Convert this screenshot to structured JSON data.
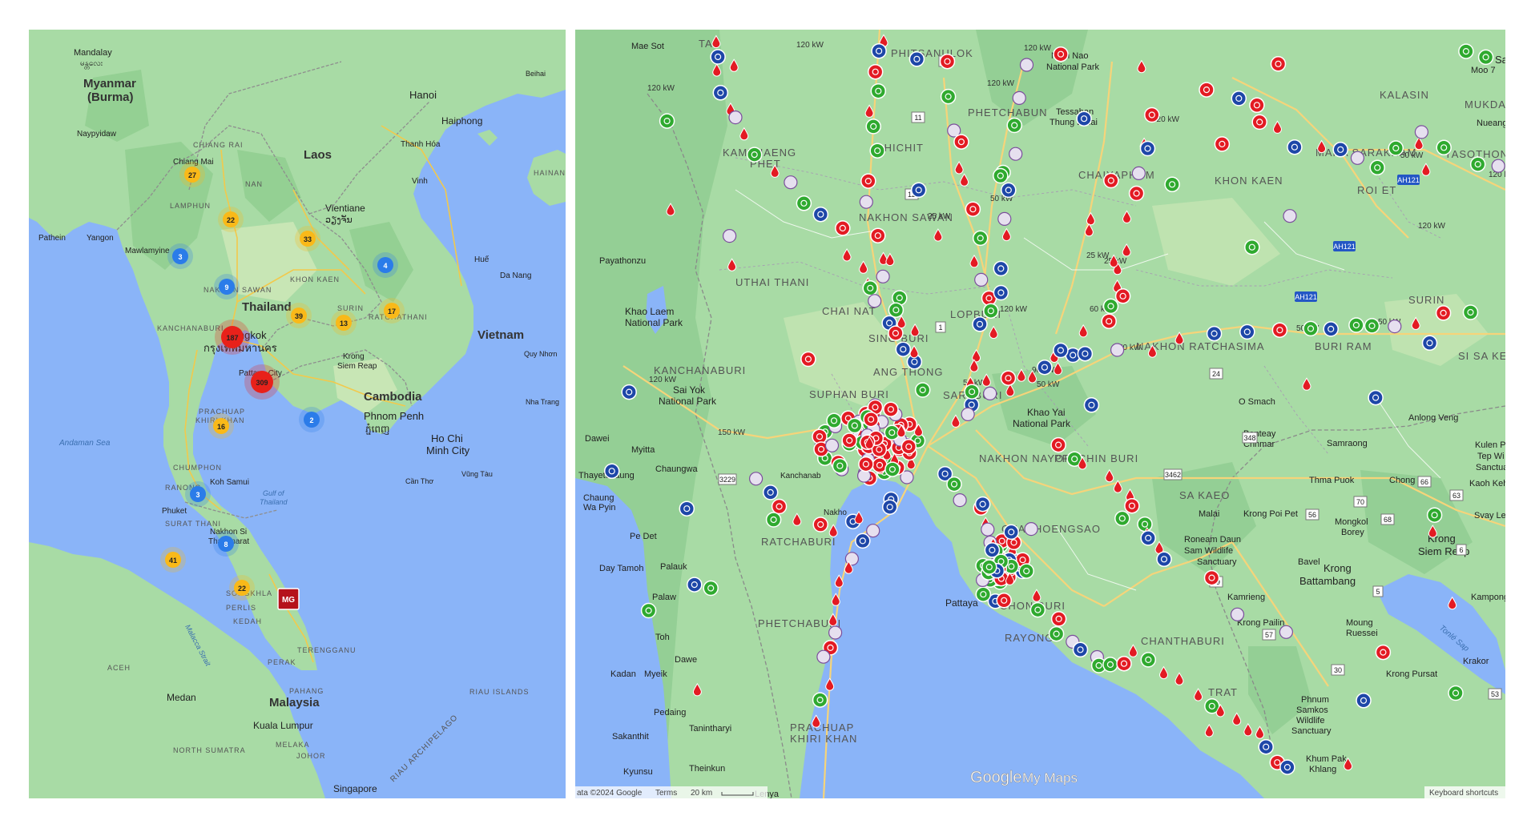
{
  "left_map": {
    "labels": {
      "countries": [
        {
          "id": "myanmar",
          "text": "Myanmar"
        },
        {
          "id": "myanmar2",
          "text": "(Burma)"
        },
        {
          "id": "thailand",
          "text": "Thailand"
        },
        {
          "id": "laos",
          "text": "Laos"
        },
        {
          "id": "cambodia",
          "text": "Cambodia"
        },
        {
          "id": "vietnam",
          "text": "Vietnam"
        },
        {
          "id": "malaysia",
          "text": "Malaysia"
        }
      ],
      "cities": [
        {
          "id": "mandalay",
          "text": "Mandalay"
        },
        {
          "id": "mandalay_local",
          "text": "မန္တလေး"
        },
        {
          "id": "naypyidaw",
          "text": "Naypyidaw"
        },
        {
          "id": "yangon",
          "text": "Yangon"
        },
        {
          "id": "pathein",
          "text": "Pathein"
        },
        {
          "id": "mawlamyine",
          "text": "Mawlamyine"
        },
        {
          "id": "chiangmai",
          "text": "Chiang Mai"
        },
        {
          "id": "hanoi",
          "text": "Hanoi"
        },
        {
          "id": "haiphong",
          "text": "Haiphong"
        },
        {
          "id": "vientiane",
          "text": "Vientiane"
        },
        {
          "id": "vientiane_local",
          "text": "ວຽງຈັນ"
        },
        {
          "id": "bangkok",
          "text": "Bangkok"
        },
        {
          "id": "bangkok_local",
          "text": "กรุงเทพมหานคร"
        },
        {
          "id": "pattaya",
          "text": "Pattaya City"
        },
        {
          "id": "phnompenh",
          "text": "Phnom Penh"
        },
        {
          "id": "phnompenh_local",
          "text": "ភ្នំពេញ"
        },
        {
          "id": "hcmc",
          "text": "Ho Chi"
        },
        {
          "id": "hcmc2",
          "text": "Minh City"
        },
        {
          "id": "siemreap",
          "text": "Krong"
        },
        {
          "id": "siemreap2",
          "text": "Siem Reap"
        },
        {
          "id": "danang",
          "text": "Da Nang"
        },
        {
          "id": "hue",
          "text": "Huế"
        },
        {
          "id": "vinh",
          "text": "Vinh"
        },
        {
          "id": "thanhhoa",
          "text": "Thanh Hóa"
        },
        {
          "id": "kualalumpur",
          "text": "Kuala Lumpur"
        },
        {
          "id": "singapore",
          "text": "Singapore"
        },
        {
          "id": "medan",
          "text": "Medan"
        },
        {
          "id": "phuket",
          "text": "Phuket"
        },
        {
          "id": "kohsamui",
          "text": "Koh Samui"
        },
        {
          "id": "nakhonsi",
          "text": "Nakhon Si"
        },
        {
          "id": "nakhonsi2",
          "text": "Thammarat"
        },
        {
          "id": "canthos",
          "text": "Cần Thơ"
        },
        {
          "id": "vungtau",
          "text": "Vũng Tàu"
        },
        {
          "id": "quynhon",
          "text": "Quy Nhơn"
        },
        {
          "id": "nhatrang",
          "text": "Nha Trang"
        },
        {
          "id": "beihai",
          "text": "Beihai"
        }
      ],
      "provinces": [
        {
          "id": "chiangrai",
          "text": "CHIANG RAI"
        },
        {
          "id": "lamphun",
          "text": "LAMPHUN"
        },
        {
          "id": "nan",
          "text": "NAN"
        },
        {
          "id": "nakhonsawan",
          "text": "NAKHON SAWAN"
        },
        {
          "id": "khonkaen",
          "text": "KHON KAEN"
        },
        {
          "id": "kanchanaburi",
          "text": "KANCHANABURI"
        },
        {
          "id": "prachuap",
          "text": "PRACHUAP"
        },
        {
          "id": "prachuap2",
          "text": "KHIRI KHAN"
        },
        {
          "id": "chumphon",
          "text": "CHUMPHON"
        },
        {
          "id": "ranong",
          "text": "RANONG"
        },
        {
          "id": "suratthani",
          "text": "SURAT THANI"
        },
        {
          "id": "songkhla",
          "text": "SONGKHLA"
        },
        {
          "id": "perlis",
          "text": "PERLIS"
        },
        {
          "id": "kedah",
          "text": "KEDAH"
        },
        {
          "id": "perak",
          "text": "PERAK"
        },
        {
          "id": "terengganu",
          "text": "TERENGGANU"
        },
        {
          "id": "pahang",
          "text": "PAHANG"
        },
        {
          "id": "melaka",
          "text": "MELAKA"
        },
        {
          "id": "johor",
          "text": "JOHOR"
        },
        {
          "id": "aceh",
          "text": "ACEH"
        },
        {
          "id": "northsumatra",
          "text": "NORTH SUMATRA"
        },
        {
          "id": "riauislands",
          "text": "RIAU ISLANDS"
        },
        {
          "id": "riauarch",
          "text": "RIAU ARCHIPELAGO"
        },
        {
          "id": "surin",
          "text": "SURIN"
        },
        {
          "id": "ratchathani",
          "text": "RATCHATHANI"
        },
        {
          "id": "hainan",
          "text": "HAINAN"
        }
      ],
      "seas": [
        {
          "id": "andaman",
          "text": "Andaman Sea"
        },
        {
          "id": "gulf",
          "text": "Gulf of"
        },
        {
          "id": "gulf2",
          "text": "Thailand"
        },
        {
          "id": "malacca",
          "text": "Malacca Strait"
        }
      ]
    },
    "clusters": [
      {
        "count": "27",
        "color": "#f9b919"
      },
      {
        "count": "22",
        "color": "#f9b919"
      },
      {
        "count": "3",
        "color": "#2b7ce9"
      },
      {
        "count": "33",
        "color": "#f9b919"
      },
      {
        "count": "4",
        "color": "#2b7ce9"
      },
      {
        "count": "9",
        "color": "#2b7ce9"
      },
      {
        "count": "39",
        "color": "#f9b919"
      },
      {
        "count": "13",
        "color": "#f9b919"
      },
      {
        "count": "17",
        "color": "#f9b919"
      },
      {
        "count": "187",
        "color": "#e8211a"
      },
      {
        "count": "309",
        "color": "#e8211a"
      },
      {
        "count": "2",
        "color": "#2b7ce9"
      },
      {
        "count": "16",
        "color": "#f9b919"
      },
      {
        "count": "3",
        "color": "#2b7ce9"
      },
      {
        "count": "8",
        "color": "#2b7ce9"
      },
      {
        "count": "41",
        "color": "#f9b919"
      },
      {
        "count": "22",
        "color": "#f9b919"
      }
    ],
    "mg_marker": "MG"
  },
  "right_map": {
    "labels": {
      "provinces": [
        {
          "id": "tak",
          "text": "TAK"
        },
        {
          "id": "phitsanulok",
          "text": "PHITSANULOK"
        },
        {
          "id": "phetchabun",
          "text": "PHETCHABUN"
        },
        {
          "id": "kamphaengphet",
          "text": "KAMPHAENG"
        },
        {
          "id": "kamphaengphet2",
          "text": "PHET"
        },
        {
          "id": "phichit",
          "text": "PHICHIT"
        },
        {
          "id": "chaiyaphum",
          "text": "CHAIYAPHUM"
        },
        {
          "id": "khonkaen",
          "text": "KHON KAEN"
        },
        {
          "id": "kalasin",
          "text": "KALASIN"
        },
        {
          "id": "mukdahan",
          "text": "MUKDAHAN"
        },
        {
          "id": "maha",
          "text": "MAHA SARAKHAM"
        },
        {
          "id": "yasothon",
          "text": "YASOTHON"
        },
        {
          "id": "roiet",
          "text": "ROI ET"
        },
        {
          "id": "nakhonsawan",
          "text": "NAKHON SAWAN"
        },
        {
          "id": "uthaithani",
          "text": "UTHAI THANI"
        },
        {
          "id": "chainat",
          "text": "CHAI NAT"
        },
        {
          "id": "lopburi",
          "text": "LOPBURI"
        },
        {
          "id": "singburi",
          "text": "SING BURI"
        },
        {
          "id": "angthong",
          "text": "ANG THONG"
        },
        {
          "id": "kanchanaburi",
          "text": "KANCHANABURI"
        },
        {
          "id": "suphanburi",
          "text": "SUPHAN BURI"
        },
        {
          "id": "saraburi",
          "text": "SARABURI"
        },
        {
          "id": "nakhonratchasima",
          "text": "NAKHON RATCHASIMA"
        },
        {
          "id": "buriram",
          "text": "BURI RAM"
        },
        {
          "id": "surin",
          "text": "SURIN"
        },
        {
          "id": "sisaket",
          "text": "SI SA KET"
        },
        {
          "id": "nakhonnayok",
          "text": "NAKHON NAYOK"
        },
        {
          "id": "prachinburi",
          "text": "PRACHIN BURI"
        },
        {
          "id": "sakaeo",
          "text": "SA KAEO"
        },
        {
          "id": "chachoengsao",
          "text": "CHACHOENGSAO"
        },
        {
          "id": "ratchaburi",
          "text": "RATCHABURI"
        },
        {
          "id": "phetchaburi",
          "text": "PHETCHABURI"
        },
        {
          "id": "chonburi",
          "text": "CHON BURI"
        },
        {
          "id": "rayong",
          "text": "RAYONG"
        },
        {
          "id": "chanthaburi",
          "text": "CHANTHABURI"
        },
        {
          "id": "trat",
          "text": "TRAT"
        },
        {
          "id": "prachuap",
          "text": "PRACHUAP"
        },
        {
          "id": "prachuap2",
          "text": "KHIRI KHAN"
        }
      ],
      "places": [
        {
          "id": "maesot",
          "text": "Mae Sot"
        },
        {
          "id": "namnao",
          "text": "Nam Nao"
        },
        {
          "id": "namnao2",
          "text": "National Park"
        },
        {
          "id": "tessaban",
          "text": "Tessaban"
        },
        {
          "id": "tessaban2",
          "text": "Thung Luilai"
        },
        {
          "id": "payathonzu",
          "text": "Payathonzu"
        },
        {
          "id": "khaolaem",
          "text": "Khao Laem"
        },
        {
          "id": "khaolaem2",
          "text": "National Park"
        },
        {
          "id": "saiyok",
          "text": "Sai Yok"
        },
        {
          "id": "saiyok2",
          "text": "National Park"
        },
        {
          "id": "khaoyai",
          "text": "Khao Yai"
        },
        {
          "id": "khaoyai2",
          "text": "National Park"
        },
        {
          "id": "thanbyuzayat",
          "text": "Dawei"
        },
        {
          "id": "myitta",
          "text": "Myitta"
        },
        {
          "id": "chaungwa",
          "text": "Chaungwa"
        },
        {
          "id": "thayetchaung",
          "text": "Thayetchaung"
        },
        {
          "id": "chaung",
          "text": "Chaung"
        },
        {
          "id": "wapyin",
          "text": "Wa Pyin"
        },
        {
          "id": "pedet",
          "text": "Pe Det"
        },
        {
          "id": "daytamoh",
          "text": "Day Tamoh"
        },
        {
          "id": "palauk",
          "text": "Palauk"
        },
        {
          "id": "palaw",
          "text": "Palaw"
        },
        {
          "id": "toh",
          "text": "Toh"
        },
        {
          "id": "dawe",
          "text": "Dawe"
        },
        {
          "id": "kadan",
          "text": "Kadan"
        },
        {
          "id": "myeik",
          "text": "Myeik"
        },
        {
          "id": "pedaing",
          "text": "Pedaing"
        },
        {
          "id": "tanintharyi",
          "text": "Tanintharyi"
        },
        {
          "id": "sakanthit",
          "text": "Sakanthit"
        },
        {
          "id": "theinkun",
          "text": "Theinkun"
        },
        {
          "id": "kyunsu",
          "text": "Kyunsu"
        },
        {
          "id": "lenya",
          "text": "Lenya"
        },
        {
          "id": "pattaya",
          "text": "Pattaya"
        },
        {
          "id": "osmach",
          "text": "O Smach"
        },
        {
          "id": "banteay",
          "text": "Banteay"
        },
        {
          "id": "banteay2",
          "text": "Chhmar"
        },
        {
          "id": "samraong",
          "text": "Samraong"
        },
        {
          "id": "anlongveng",
          "text": "Anlong Veng"
        },
        {
          "id": "kulen",
          "text": "Kulen Pr"
        },
        {
          "id": "kulen2",
          "text": "Tep Wi"
        },
        {
          "id": "kulen3",
          "text": "Sanctua"
        },
        {
          "id": "thmapuok",
          "text": "Thma Puok"
        },
        {
          "id": "chongkal",
          "text": "Chong Kal"
        },
        {
          "id": "kaokeh",
          "text": "Kaoh Keh"
        },
        {
          "id": "kongpoipet",
          "text": "Krong Poi Pet"
        },
        {
          "id": "mongkol",
          "text": "Mongkol"
        },
        {
          "id": "mongkol2",
          "text": "Borey"
        },
        {
          "id": "svayleu",
          "text": "Svay Le"
        },
        {
          "id": "siemreap",
          "text": "Krong"
        },
        {
          "id": "siemreap2",
          "text": "Siem Reap"
        },
        {
          "id": "battambang",
          "text": "Krong"
        },
        {
          "id": "battambang2",
          "text": "Battambang"
        },
        {
          "id": "roneam",
          "text": "Roneam Daun"
        },
        {
          "id": "roneam2",
          "text": "Sam Wildlife"
        },
        {
          "id": "roneam3",
          "text": "Sanctuary"
        },
        {
          "id": "bavel",
          "text": "Bavel"
        },
        {
          "id": "kamrieng",
          "text": "Kamrieng"
        },
        {
          "id": "pailin",
          "text": "Krong Pailin"
        },
        {
          "id": "moung",
          "text": "Moung"
        },
        {
          "id": "moung2",
          "text": "Ruessei"
        },
        {
          "id": "kompong",
          "text": "Kampong"
        },
        {
          "id": "pursat",
          "text": "Krong Pursat"
        },
        {
          "id": "krakor",
          "text": "Krakor"
        },
        {
          "id": "phnumsamkos",
          "text": "Phnum"
        },
        {
          "id": "phnumsamkos2",
          "text": "Samkos"
        },
        {
          "id": "phnumsamkos3",
          "text": "Wildlife"
        },
        {
          "id": "phnumsamkos4",
          "text": "Sanctuary"
        },
        {
          "id": "khumpak",
          "text": "Khum Pak"
        },
        {
          "id": "khumpak2",
          "text": "Khlang"
        },
        {
          "id": "tonlesap",
          "text": "Tonlé Sap"
        },
        {
          "id": "kanchanab",
          "text": "Kanchanab"
        },
        {
          "id": "nakhon",
          "text": "Nakho"
        },
        {
          "id": "moo7",
          "text": "Moo 7"
        },
        {
          "id": "sa",
          "text": "Sa"
        },
        {
          "id": "malai",
          "text": "Malai"
        },
        {
          "id": "nueang",
          "text": "Nueang"
        }
      ],
      "power": [
        "120 kW",
        "120 kW",
        "120 kW",
        "120 kW",
        "120 kW",
        "25 kW",
        "50 kW",
        "25 kW",
        "120 kW",
        "60 kW",
        "50 kW",
        "90 kW",
        "50 kW",
        "50 kW",
        "150 kW",
        "120 kW",
        "50 kW",
        "120 kW",
        "120 kW",
        "25 kW",
        "50 kW",
        "50 kW"
      ],
      "roads": [
        "AH121",
        "AH121",
        "AH121",
        "1",
        "11",
        "12",
        "3229",
        "3462",
        "348",
        "24",
        "66",
        "68",
        "56",
        "57",
        "5",
        "59",
        "6",
        "63",
        "70",
        "53",
        "30",
        "1"
      ]
    },
    "footer": {
      "data": "ata ©2024 Google",
      "terms": "Terms",
      "scale": "20 km",
      "keyboard": "Keyboard shortcuts",
      "brand_google": "Google",
      "brand_mymaps": "My Maps"
    },
    "colors": {
      "land": "#a8dba5",
      "sea": "#8ab4f8",
      "forest": "#94d093",
      "red": "#e31b23",
      "blue": "#1e47a8",
      "green": "#2faa2f",
      "pea": "#7b4e9c"
    }
  }
}
